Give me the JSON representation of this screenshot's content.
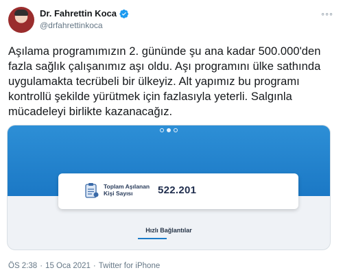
{
  "author": {
    "name": "Dr. Fahrettin Koca",
    "handle": "@drfahrettinkoca",
    "avatar_icon": "profile-photo",
    "verified_icon": "verified-badge-icon"
  },
  "menu": {
    "more_glyph": "◦◦◦"
  },
  "tweet": {
    "text": "Aşılama programımızın 2. gününde şu ana kadar 500.000'den fazla sağlık çalışanımız aşı oldu. Aşı programını ülke sathında uygulamakta tecrübeli bir ülkeyiz. Alt yapımız bu programı kontrollü şekilde yürütmek için fazlasıyla yeterli. Salgınla mücadeleyi birlikte kazanacağız."
  },
  "media": {
    "stat_label_line1": "Toplam Aşılanan",
    "stat_label_line2": "Kişi Sayısı",
    "stat_value": "522.201",
    "quick_links": "Hızlı Bağlantılar",
    "carousel_dots": 3,
    "carousel_active_index": 1
  },
  "footer": {
    "time": "ÖS 2:38",
    "separator": "·",
    "date": "15 Oca 2021",
    "separator2": "·",
    "source": "Twitter for iPhone"
  },
  "colors": {
    "accent": "#1d9bf0",
    "media_blue": "#1b78c5",
    "muted": "#657786"
  }
}
